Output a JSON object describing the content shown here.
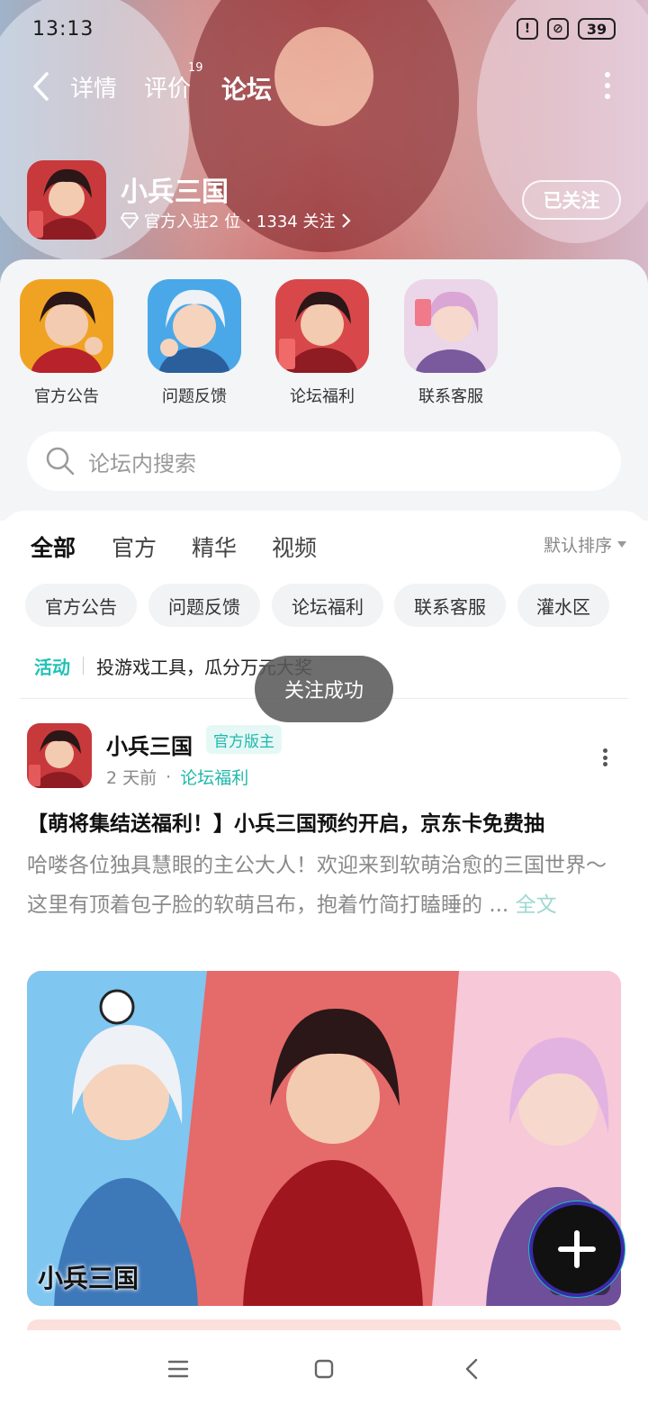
{
  "status_bar": {
    "time": "13:13",
    "battery": "39",
    "alert_icon": "alert-icon",
    "dnd_icon": "no-disturb-icon"
  },
  "top_nav": {
    "tabs": [
      {
        "label": "详情"
      },
      {
        "label": "评价",
        "badge": "19"
      },
      {
        "label": "论坛",
        "active": true
      }
    ],
    "back_icon": "chevron-left-icon",
    "more_icon": "more-vertical-icon"
  },
  "game": {
    "name": "小兵三国",
    "meta_official": "官方入驻2 位",
    "meta_dot": "·",
    "meta_followers": "1334 关注",
    "follow_button": "已关注"
  },
  "quick_links": [
    {
      "label": "官方公告"
    },
    {
      "label": "问题反馈"
    },
    {
      "label": "论坛福利"
    },
    {
      "label": "联系客服"
    }
  ],
  "search": {
    "placeholder": "论坛内搜索"
  },
  "feed_tabs": {
    "items": [
      {
        "label": "全部",
        "active": true
      },
      {
        "label": "官方"
      },
      {
        "label": "精华"
      },
      {
        "label": "视频"
      }
    ],
    "sort_label": "默认排序"
  },
  "chips": [
    "官方公告",
    "问题反馈",
    "论坛福利",
    "联系客服",
    "灌水区"
  ],
  "activity": {
    "tag": "活动",
    "text": "投游戏工具，瓜分万元大奖"
  },
  "toast": {
    "text": "关注成功"
  },
  "post": {
    "author": "小兵三国",
    "badge": "官方版主",
    "time": "2 天前",
    "dot": "·",
    "category": "论坛福利",
    "title": "【萌将集结送福利！】小兵三国预约开启，京东卡免费抽",
    "body_line1": "哈喽各位独具慧眼的主公大人！欢迎来到软萌治愈的三国世界～",
    "body_line2": "这里有顶着包子脸的软萌吕布，抱着竹简打瞌睡的",
    "ellipsis": "...",
    "full_text": "全文",
    "image_logo": "小兵三国",
    "image_count": "2"
  },
  "fab": {
    "icon": "plus-icon"
  },
  "system_nav": {
    "menu_icon": "menu-icon",
    "home_icon": "home-square-icon",
    "back_icon": "back-triangle-icon"
  },
  "colors": {
    "accent": "#28d1c3",
    "accent_text": "#1fb8ab",
    "toast_bg": "#5a5a5a"
  }
}
